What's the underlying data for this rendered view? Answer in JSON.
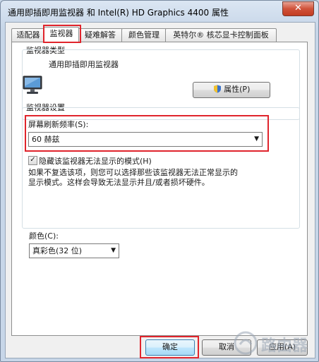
{
  "window": {
    "title": "通用即插即用监视器 和 Intel(R) HD Graphics 4400 属性",
    "close_label": "✕"
  },
  "tabs": [
    {
      "label": "适配器"
    },
    {
      "label": "监视器"
    },
    {
      "label": "疑难解答"
    },
    {
      "label": "颜色管理"
    },
    {
      "label": "英特尔® 核芯显卡控制面板"
    }
  ],
  "monitor_type": {
    "group_label": "监视器类型",
    "monitor_name": "通用即插即用监视器",
    "properties_button": "属性(P)"
  },
  "monitor_settings": {
    "group_label": "监视器设置",
    "refresh_label": "屏幕刷新频率(S):",
    "refresh_value": "60 赫兹",
    "hide_modes_label": "隐藏该监视器无法显示的模式(H)",
    "hide_modes_checked": true,
    "description_line1": "如果不复选该项，则您可以选择那些该监视器无法正常显示的",
    "description_line2": "显示模式。这样会导致无法显示并且/或者损坏硬件。"
  },
  "color": {
    "label": "颜色(C):",
    "value": "真彩色(32 位)"
  },
  "buttons": {
    "ok": "确定",
    "cancel": "取消",
    "apply": "应用(A)"
  },
  "watermark": {
    "text": "路由器"
  }
}
